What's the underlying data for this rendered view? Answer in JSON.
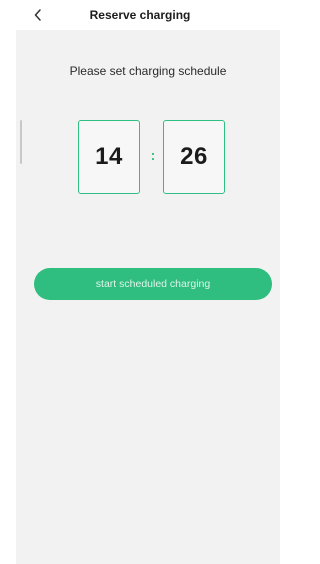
{
  "header": {
    "back_icon": "chevron-left-icon",
    "title": "Reserve charging"
  },
  "main": {
    "instruction": "Please set charging schedule",
    "time": {
      "hours": "14",
      "separator": ":",
      "minutes": "26"
    },
    "start_button_label": "start scheduled charging"
  },
  "colors": {
    "accent": "#2fbf83",
    "background": "#f2f2f2"
  }
}
